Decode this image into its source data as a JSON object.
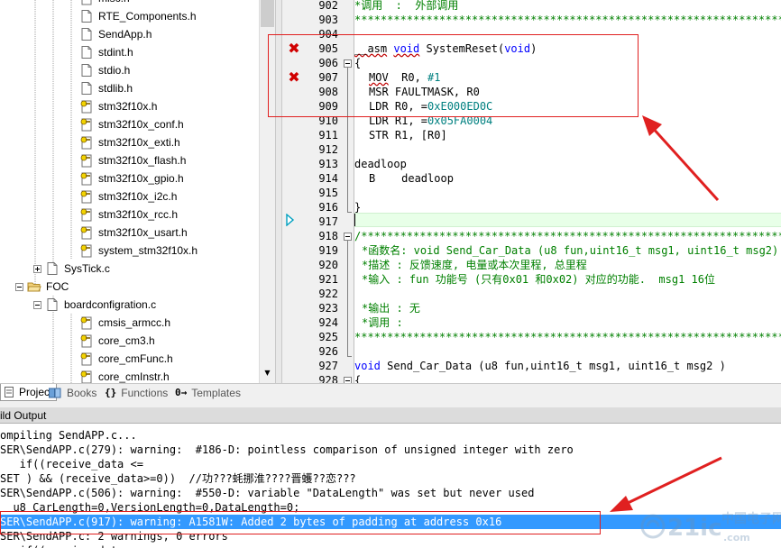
{
  "tree": {
    "items": [
      {
        "label": "misc.h",
        "icon": "key-file-icon"
      },
      {
        "label": "RTE_Components.h",
        "icon": "file-icon"
      },
      {
        "label": "SendApp.h",
        "icon": "file-icon"
      },
      {
        "label": "stdint.h",
        "icon": "file-icon"
      },
      {
        "label": "stdio.h",
        "icon": "file-icon"
      },
      {
        "label": "stdlib.h",
        "icon": "file-icon"
      },
      {
        "label": "stm32f10x.h",
        "icon": "key-file-icon"
      },
      {
        "label": "stm32f10x_conf.h",
        "icon": "key-file-icon"
      },
      {
        "label": "stm32f10x_exti.h",
        "icon": "key-file-icon"
      },
      {
        "label": "stm32f10x_flash.h",
        "icon": "key-file-icon"
      },
      {
        "label": "stm32f10x_gpio.h",
        "icon": "key-file-icon"
      },
      {
        "label": "stm32f10x_i2c.h",
        "icon": "key-file-icon"
      },
      {
        "label": "stm32f10x_rcc.h",
        "icon": "key-file-icon"
      },
      {
        "label": "stm32f10x_usart.h",
        "icon": "key-file-icon"
      },
      {
        "label": "system_stm32f10x.h",
        "icon": "key-file-icon"
      },
      {
        "label": "SysTick.c",
        "icon": "file-icon"
      },
      {
        "label": "FOC",
        "icon": "folder-open-icon"
      },
      {
        "label": "boardconfigration.c",
        "icon": "file-icon"
      },
      {
        "label": "cmsis_armcc.h",
        "icon": "key-file-icon"
      },
      {
        "label": "core_cm3.h",
        "icon": "key-file-icon"
      },
      {
        "label": "core_cmFunc.h",
        "icon": "key-file-icon"
      },
      {
        "label": "core_cmInstr.h",
        "icon": "key-file-icon"
      }
    ]
  },
  "tabs": [
    {
      "label": "Project",
      "icon": "project-icon",
      "active": true
    },
    {
      "label": "Books",
      "icon": "books-icon",
      "active": false
    },
    {
      "label": "Functions",
      "icon": "braces-icon",
      "active": false
    },
    {
      "label": "Templates",
      "icon": "templates-icon",
      "active": false
    }
  ],
  "editor": {
    "line_numbers": [
      "902",
      "903",
      "904",
      "905",
      "906",
      "907",
      "908",
      "909",
      "910",
      "911",
      "912",
      "913",
      "914",
      "915",
      "916",
      "917",
      "918",
      "919",
      "920",
      "921",
      "922",
      "923",
      "924",
      "925",
      "926",
      "927",
      "928"
    ],
    "lines": {
      "l902": "*调用  :  外部调用",
      "l903": "*******************************************************************************",
      "l905_a": "__asm",
      "l905_b": "void",
      "l905_c": " SystemReset(",
      "l905_d": "void",
      "l905_e": ")",
      "l906": "{",
      "l907_a": "MOV",
      "l907_b": "  R0, ",
      "l907_c": "#1",
      "l908": "MSR FAULTMASK, R0",
      "l909_a": "LDR R0, =",
      "l909_b": "0xE000ED0C",
      "l910_a": "LDR R1, =",
      "l910_b": "0x05FA0004",
      "l911": "STR R1, [R0]",
      "l913": "deadloop",
      "l914": "B    deadloop",
      "l916": "}",
      "l918": "/*******************************************************************************",
      "l919": "*函数名: void Send_Car_Data (u8 fun,uint16_t msg1, uint16_t msg2)",
      "l920": "*描述 : 反馈速度, 电量或本次里程, 总里程",
      "l921": "*输入 : fun 功能号 (只有0x01 和0x02) 对应的功能.  msg1 16位",
      "l923": "*输出 : 无",
      "l924": "*调用 :",
      "l925": "*******************************************************************************",
      "l927_a": "void",
      "l927_b": " Send_Car_Data (u8 fun,uint16_t msg1, uint16_t msg2 )",
      "l928": "{"
    }
  },
  "output": {
    "title": "ild Output",
    "lines": [
      "ompiling SendAPP.c...",
      "SER\\SendAPP.c(279): warning:  #186-D: pointless comparison of unsigned integer with zero",
      "   if((receive_data <=",
      "SET ) && (receive_data>=0))  //功???蚝挪淮????晋蠖??恋???",
      "SER\\SendAPP.c(506): warning:  #550-D: variable \"DataLength\" was set but never used",
      "  u8 CarLength=0,VersionLength=0,DataLength=0;",
      "SER\\SendAPP.c(917): warning: A1581W: Added 2 bytes of padding at address 0x16",
      "SER\\SendAPP.c: 2 warnings, 0 errors",
      "   if((receive_data <="
    ],
    "selected_index": 6
  },
  "colors": {
    "annotation_red": "#e02020",
    "selection_blue": "#3399ff",
    "comment_green": "#008000",
    "keyword_blue": "#0000ff",
    "number_teal": "#008080",
    "error_red": "#d00000",
    "current_line": "#e8ffe8"
  }
}
